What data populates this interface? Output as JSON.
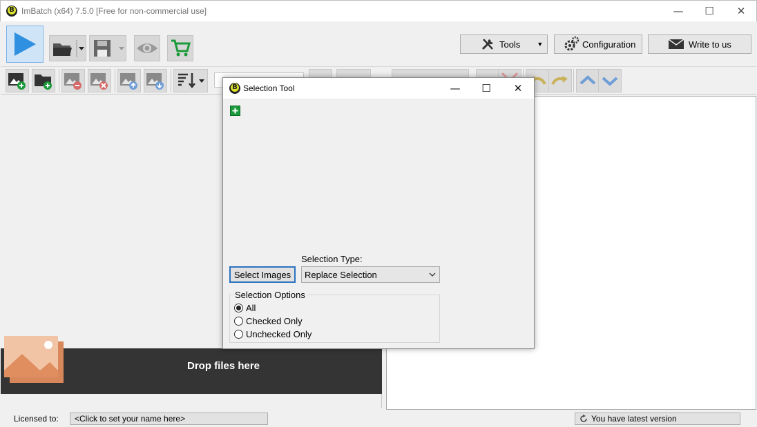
{
  "window": {
    "title": "ImBatch (x64) 7.5.0 [Free for non-commercial use]",
    "minimize": "—",
    "maximize": "☐",
    "close": "✕"
  },
  "toolbar": {
    "tools_label": "Tools",
    "configuration_label": "Configuration",
    "write_label": "Write to us"
  },
  "drop_area": {
    "text": "Drop files here"
  },
  "status": {
    "licensed_label": "Licensed to:",
    "licensed_value": "<Click to set your name here>",
    "version_text": "You have latest version"
  },
  "dialog": {
    "title": "Selection Tool",
    "minimize": "—",
    "maximize": "☐",
    "close": "✕",
    "select_images_label": "Select Images",
    "selection_type_label": "Selection Type:",
    "selection_type_value": "Replace Selection",
    "options_group_label": "Selection Options",
    "options": [
      {
        "label": "All",
        "checked": true
      },
      {
        "label": "Checked Only",
        "checked": false
      },
      {
        "label": "Unchecked Only",
        "checked": false
      }
    ]
  },
  "colors": {
    "accent_blue": "#2f8fe0",
    "cart_green": "#1a9a3a",
    "drop_bg": "#343434"
  }
}
